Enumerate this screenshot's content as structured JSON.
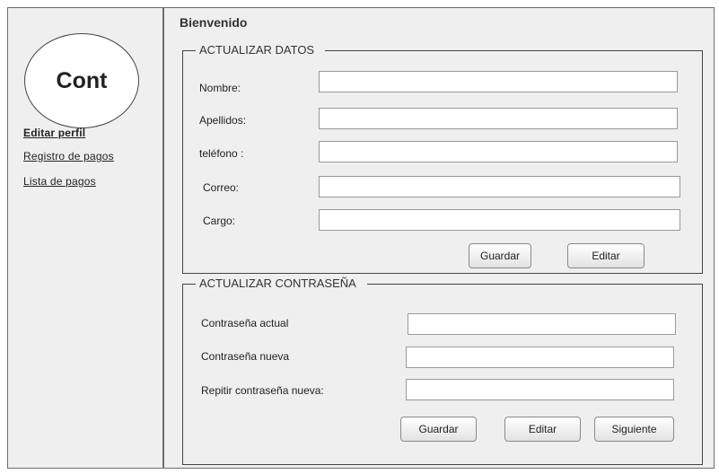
{
  "sidebar": {
    "logo_text": "Cont",
    "links": [
      {
        "label": "Editar perfil"
      },
      {
        "label": "Registro de pagos"
      },
      {
        "label": "Lista de pagos"
      }
    ]
  },
  "header": {
    "welcome": "Bienvenido"
  },
  "update_data": {
    "title": "ACTUALIZAR DATOS",
    "fields": [
      {
        "label": "Nombre:",
        "value": ""
      },
      {
        "label": "Apellidos:",
        "value": ""
      },
      {
        "label": "teléfono :",
        "value": ""
      },
      {
        "label": "Correo:",
        "value": ""
      },
      {
        "label": "Cargo:",
        "value": ""
      }
    ],
    "save_label": "Guardar",
    "edit_label": "Editar"
  },
  "update_password": {
    "title": "ACTUALIZAR CONTRASEÑA",
    "fields": [
      {
        "label": "Contraseña actual",
        "value": ""
      },
      {
        "label": "Contraseña nueva",
        "value": ""
      },
      {
        "label": "Repitir contraseña nueva:",
        "value": ""
      }
    ],
    "save_label": "Guardar",
    "edit_label": "Editar",
    "next_label": "Siguiente"
  }
}
